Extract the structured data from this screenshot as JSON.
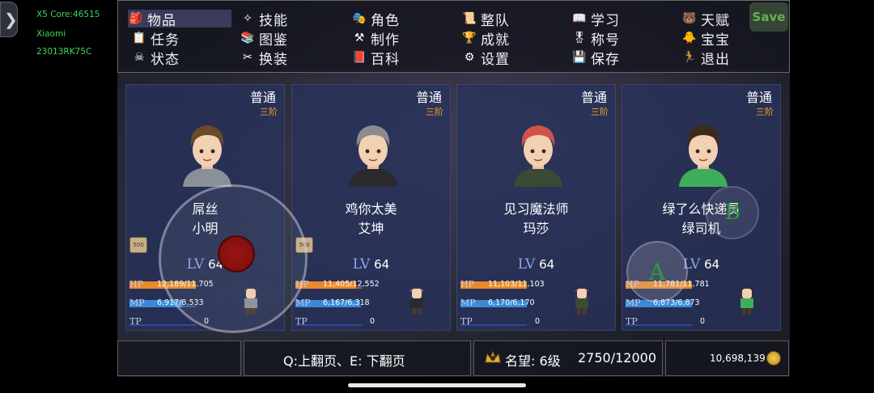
{
  "device": {
    "line1": "X5 Core:46515",
    "line2": "Xiaomi",
    "line3": "23013RK75C"
  },
  "menu": {
    "items": [
      {
        "label": "物品",
        "icon": "bag-icon",
        "glyph": "🎒"
      },
      {
        "label": "技能",
        "icon": "wing-icon",
        "glyph": "✧"
      },
      {
        "label": "角色",
        "icon": "masks-icon",
        "glyph": "🎭"
      },
      {
        "label": "整队",
        "icon": "scroll-icon",
        "glyph": "📜"
      },
      {
        "label": "学习",
        "icon": "book-icon",
        "glyph": "📖"
      },
      {
        "label": "天赋",
        "icon": "bear-icon",
        "glyph": "🐻"
      },
      {
        "label": "任务",
        "icon": "quest-icon",
        "glyph": "📋"
      },
      {
        "label": "图鉴",
        "icon": "handbook-icon",
        "glyph": "📚"
      },
      {
        "label": "制作",
        "icon": "anvil-icon",
        "glyph": "⚒"
      },
      {
        "label": "成就",
        "icon": "trophy-icon",
        "glyph": "🏆"
      },
      {
        "label": "称号",
        "icon": "medal-icon",
        "glyph": "🎖"
      },
      {
        "label": "宝宝",
        "icon": "chick-icon",
        "glyph": "🐥"
      },
      {
        "label": "状态",
        "icon": "skull-icon",
        "glyph": "☠"
      },
      {
        "label": "换装",
        "icon": "outfit-icon",
        "glyph": "✂"
      },
      {
        "label": "百科",
        "icon": "encyclopedia-icon",
        "glyph": "📕"
      },
      {
        "label": "设置",
        "icon": "gear-icon",
        "glyph": "⚙"
      },
      {
        "label": "保存",
        "icon": "floppy-icon",
        "glyph": "💾"
      },
      {
        "label": "退出",
        "icon": "exit-icon",
        "glyph": "🏃"
      }
    ],
    "save_label": "Save"
  },
  "characters": [
    {
      "difficulty": "普通",
      "rank": "三阶",
      "title": "屌丝",
      "name": "小明",
      "level_prefix": "LV",
      "level": "64",
      "badge": "500",
      "hp_label": "HP",
      "hp": "12,189/11,705",
      "hp_fraction": 1.0,
      "mp_label": "MP",
      "mp": "6,917/8,533",
      "mp_fraction": 0.81,
      "tp_label": "TP",
      "tp": "0",
      "tp_fraction": 0.0,
      "hair": "#6b4a2a",
      "accent": "#8a8f99"
    },
    {
      "difficulty": "普通",
      "rank": "三阶",
      "title": "鸡你太美",
      "name": "艾坤",
      "level_prefix": "LV",
      "level": "64",
      "badge": "500",
      "hp_label": "HP",
      "hp": "11,405/12,552",
      "hp_fraction": 0.91,
      "mp_label": "MP",
      "mp": "6,167/6,318",
      "mp_fraction": 0.98,
      "tp_label": "TP",
      "tp": "0",
      "tp_fraction": 0.0,
      "hair": "#8c8c90",
      "accent": "#2a2a2e"
    },
    {
      "difficulty": "普通",
      "rank": "三阶",
      "title": "见习魔法师",
      "name": "玛莎",
      "level_prefix": "LV",
      "level": "64",
      "hp_label": "HP",
      "hp": "11,103/11,103",
      "hp_fraction": 1.0,
      "mp_label": "MP",
      "mp": "6,170/6,170",
      "mp_fraction": 1.0,
      "tp_label": "TP",
      "tp": "0",
      "tp_fraction": 0.0,
      "hair": "#d0524a",
      "accent": "#3a4a34"
    },
    {
      "difficulty": "普通",
      "rank": "三阶",
      "title": "绿了么快递员",
      "name": "绿司机",
      "level_prefix": "LV",
      "level": "64",
      "hp_label": "HP",
      "hp": "11,781/11,781",
      "hp_fraction": 1.0,
      "mp_label": "MP",
      "mp": "6,873/6,873",
      "mp_fraction": 1.0,
      "tp_label": "TP",
      "tp": "0",
      "tp_fraction": 0.0,
      "hair": "#3e2a1a",
      "accent": "#3fae5a"
    }
  ],
  "bottom": {
    "paging_hint": "Q:上翻页、E: 下翻页",
    "reputation_label": "名望: 6级",
    "reputation_value": "2750/12000",
    "gold": "10,698,139"
  },
  "controls": {
    "a_label": "A",
    "b_label": "B"
  },
  "colors": {
    "hp_bar": "#e88a2a",
    "mp_bar": "#3a8ad8",
    "tp_bar": "#3a5ac8",
    "rank": "#f0a526"
  }
}
